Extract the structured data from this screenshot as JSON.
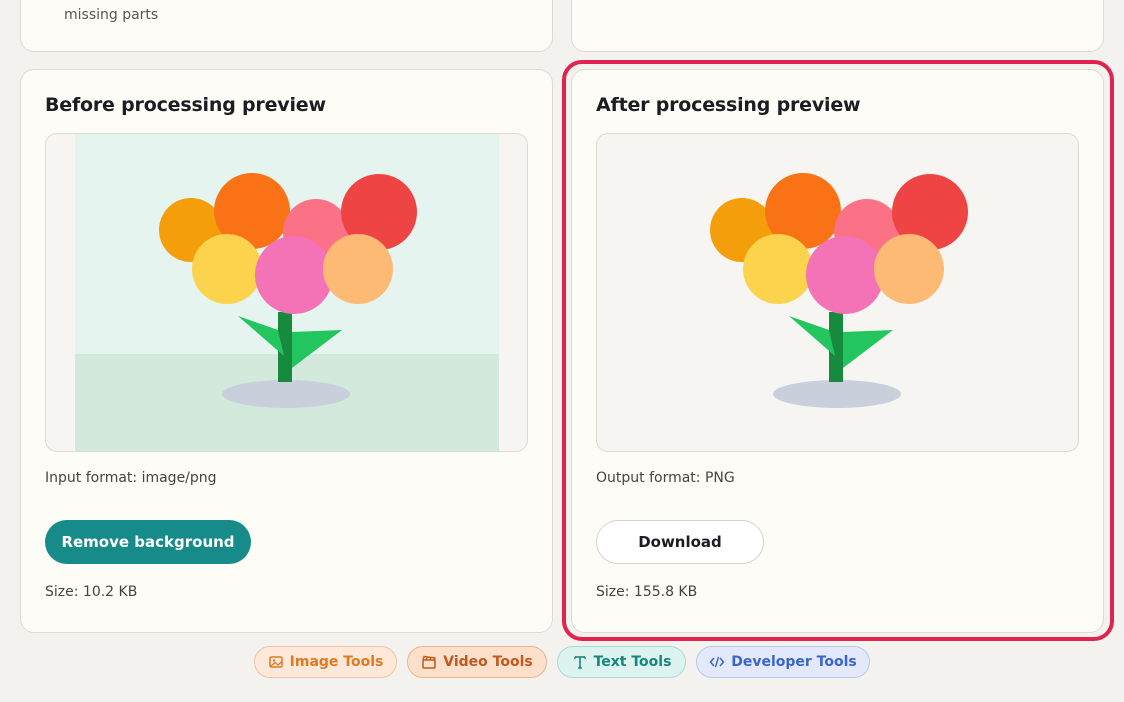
{
  "top_section": {
    "left_note": "missing parts"
  },
  "before": {
    "title": "Before processing preview",
    "format": "Input format: image/png",
    "action_label": "Remove background",
    "size": "Size: 10.2 KB"
  },
  "after": {
    "title": "After processing preview",
    "format": "Output format: PNG",
    "action_label": "Download",
    "size": "Size: 155.8 KB"
  },
  "nav_chips": [
    {
      "label": "Image Tools",
      "icon": "image-icon",
      "color": "#e2791e"
    },
    {
      "label": "Video Tools",
      "icon": "clapperboard-icon",
      "color": "#c2591a"
    },
    {
      "label": "Text Tools",
      "icon": "text-type-icon",
      "color": "#17867d"
    },
    {
      "label": "Developer Tools",
      "icon": "code-icon",
      "color": "#3a64cf"
    }
  ],
  "colors": {
    "accent": "#178a8a",
    "highlight": "#e0244f"
  }
}
